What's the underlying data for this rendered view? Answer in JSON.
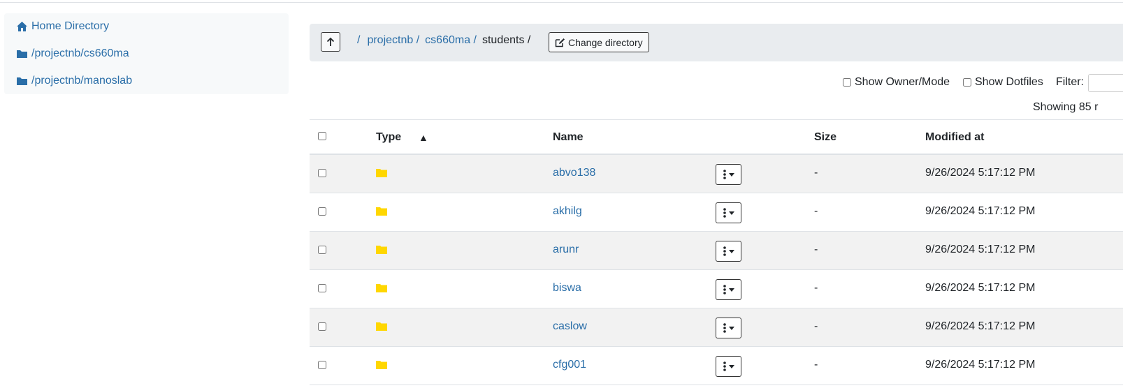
{
  "sidebar": {
    "items": [
      {
        "label": "Home Directory",
        "icon": "home-icon"
      },
      {
        "label": "/projectnb/cs660ma",
        "icon": "folder-icon"
      },
      {
        "label": "/projectnb/manoslab",
        "icon": "folder-icon"
      }
    ]
  },
  "pathbar": {
    "crumbs": [
      "/",
      "projectnb /",
      "cs660ma /",
      "students /"
    ],
    "change_dir_label": "Change directory"
  },
  "options": {
    "show_owner_mode": "Show Owner/Mode",
    "show_dotfiles": "Show Dotfiles",
    "filter_label": "Filter:",
    "showing_text": "Showing 85 r"
  },
  "table": {
    "headers": {
      "type": "Type",
      "sort_indicator": "▲",
      "name": "Name",
      "size": "Size",
      "modified": "Modified at"
    },
    "rows": [
      {
        "name": "abvo138",
        "size": "-",
        "modified": "9/26/2024 5:17:12 PM"
      },
      {
        "name": "akhilg",
        "size": "-",
        "modified": "9/26/2024 5:17:12 PM"
      },
      {
        "name": "arunr",
        "size": "-",
        "modified": "9/26/2024 5:17:12 PM"
      },
      {
        "name": "biswa",
        "size": "-",
        "modified": "9/26/2024 5:17:12 PM"
      },
      {
        "name": "caslow",
        "size": "-",
        "modified": "9/26/2024 5:17:12 PM"
      },
      {
        "name": "cfg001",
        "size": "-",
        "modified": "9/26/2024 5:17:12 PM"
      }
    ]
  },
  "colors": {
    "link": "#2a6ea8",
    "folder": "#ffd700",
    "pathbar_bg": "#e9ecef",
    "stripe": "#f2f2f2"
  }
}
